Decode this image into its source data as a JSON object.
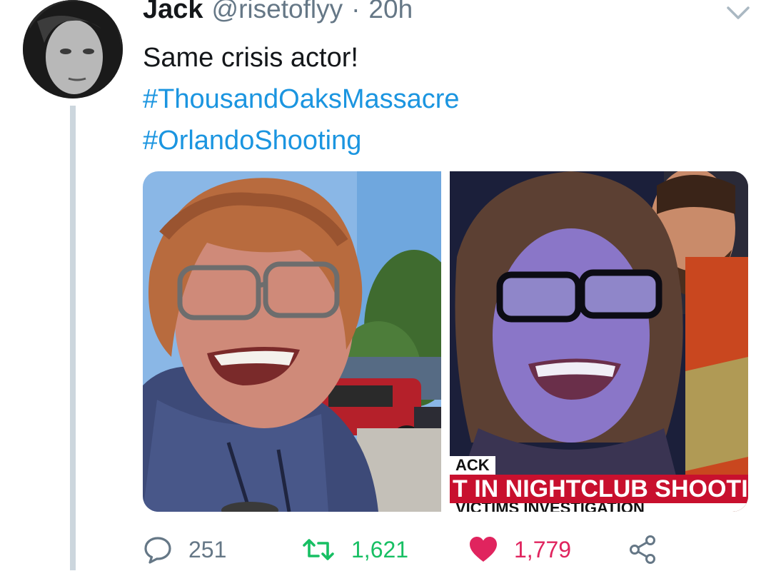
{
  "tweet": {
    "author_name": "Jack",
    "handle": "@risetoflyy",
    "separator": "·",
    "time": "20h",
    "text_line": "Same crisis actor!",
    "hashtags": [
      "#ThousandOaksMassacre",
      "#OrlandoShooting"
    ]
  },
  "media": {
    "right": {
      "chyron_tag": "ACK",
      "chyron_main": "T IN NIGHTCLUB SHOOTIN",
      "chyron_sub": "VICTIMS INVESTIGATION"
    }
  },
  "actions": {
    "replies": "251",
    "retweets": "1,621",
    "likes": "1,779"
  },
  "icons": {
    "reply": "speech-bubble-icon",
    "retweet": "retweet-arrows-icon",
    "like": "heart-icon",
    "share": "share-nodes-icon",
    "menu": "chevron-down-icon"
  },
  "colors": {
    "hashtag": "#1b95e0",
    "retweet_active": "#17bf63",
    "like_active": "#e0245e",
    "muted": "#657786",
    "thread_line": "#ccd6dd",
    "chyron_red": "#c8102e"
  }
}
